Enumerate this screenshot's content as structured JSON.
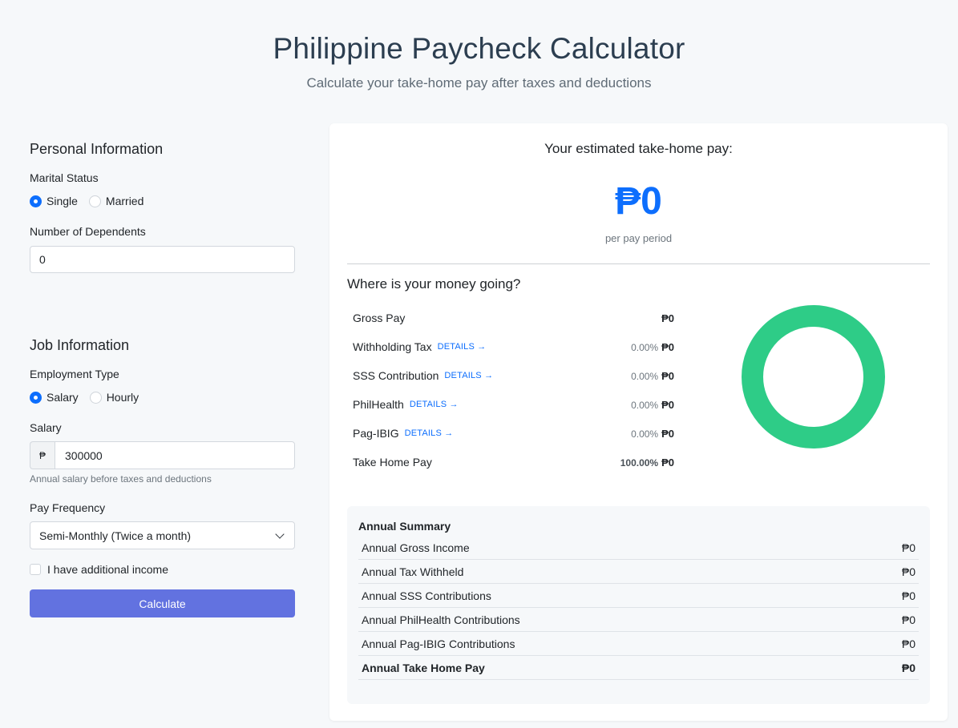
{
  "header": {
    "title": "Philippine Paycheck Calculator",
    "subtitle": "Calculate your take-home pay after taxes and deductions"
  },
  "personal": {
    "section_title": "Personal Information",
    "marital_label": "Marital Status",
    "marital_options": [
      "Single",
      "Married"
    ],
    "marital_selected": "Single",
    "dependents_label": "Number of Dependents",
    "dependents_value": "0"
  },
  "job": {
    "section_title": "Job Information",
    "employment_label": "Employment Type",
    "employment_options": [
      "Salary",
      "Hourly"
    ],
    "employment_selected": "Salary",
    "salary_label": "Salary",
    "currency_prefix": "₱",
    "salary_value": "300000",
    "salary_help": "Annual salary before taxes and deductions",
    "frequency_label": "Pay Frequency",
    "frequency_value": "Semi-Monthly (Twice a month)",
    "additional_income_label": "I have additional income",
    "additional_income_checked": false,
    "calculate_label": "Calculate"
  },
  "result": {
    "takehome_label": "Your estimated take-home pay:",
    "takehome_amount": "₱0",
    "per_period": "per pay period",
    "where_title": "Where is your money going?",
    "details_link": "DETAILS →",
    "breakdown": [
      {
        "label": "Gross Pay",
        "pct": "",
        "amount": "₱0"
      },
      {
        "label": "Withholding Tax",
        "pct": "0.00%",
        "amount": "₱0"
      },
      {
        "label": "SSS Contribution",
        "pct": "0.00%",
        "amount": "₱0"
      },
      {
        "label": "PhilHealth",
        "pct": "0.00%",
        "amount": "₱0"
      },
      {
        "label": "Pag-IBIG",
        "pct": "0.00%",
        "amount": "₱0"
      },
      {
        "label": "Take Home Pay",
        "pct": "100.00%",
        "amount": "₱0"
      }
    ],
    "donut_color": "#2ecc87"
  },
  "summary": {
    "title": "Annual Summary",
    "rows": [
      {
        "label": "Annual Gross Income",
        "value": "₱0"
      },
      {
        "label": "Annual Tax Withheld",
        "value": "₱0"
      },
      {
        "label": "Annual SSS Contributions",
        "value": "₱0"
      },
      {
        "label": "Annual PhilHealth Contributions",
        "value": "₱0"
      },
      {
        "label": "Annual Pag-IBIG Contributions",
        "value": "₱0"
      },
      {
        "label": "Annual Take Home Pay",
        "value": "₱0"
      }
    ]
  }
}
